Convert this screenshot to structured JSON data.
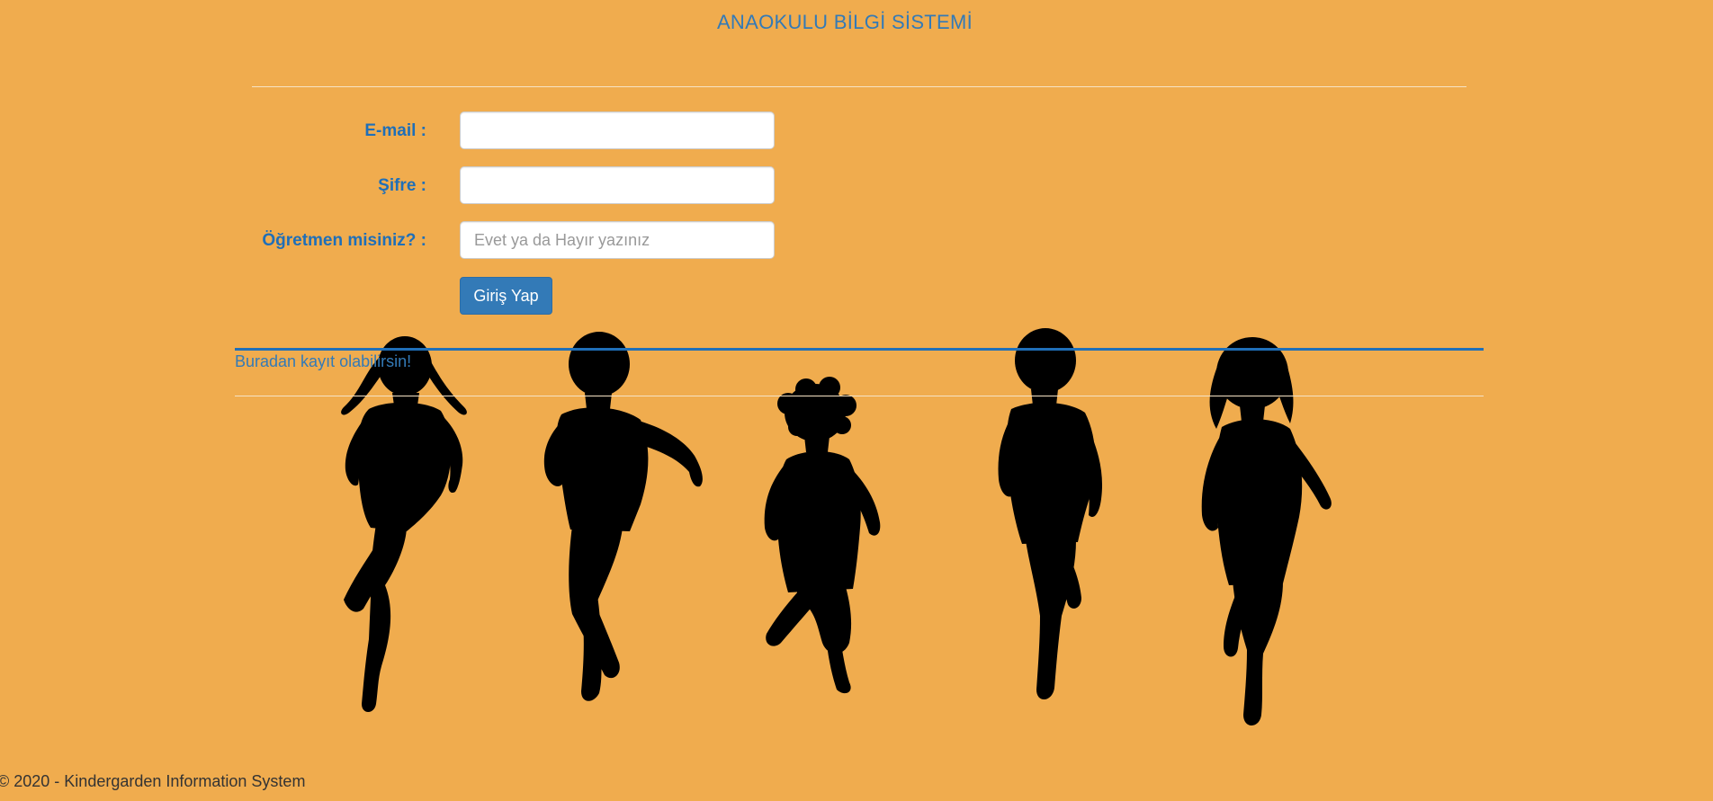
{
  "header": {
    "title": "ANAOKULU BİLGİ SİSTEMİ"
  },
  "form": {
    "email_label": "E-mail :",
    "email_value": "",
    "password_label": "Şifre :",
    "password_value": "",
    "teacher_label": "Öğretmen misiniz? :",
    "teacher_placeholder": "Evet ya da Hayır yazınız",
    "submit_label": "Giriş Yap"
  },
  "register": {
    "link_text": "Buradan kayıt olabilirsin!"
  },
  "footer": {
    "copyright": "© 2020 - Kindergarden Information System"
  },
  "colors": {
    "background": "#f0ac4e",
    "accent": "#337ab7",
    "label": "#1f6fb8",
    "silhouette": "#000000"
  },
  "decor": {
    "illustration": "running-children-silhouettes"
  }
}
